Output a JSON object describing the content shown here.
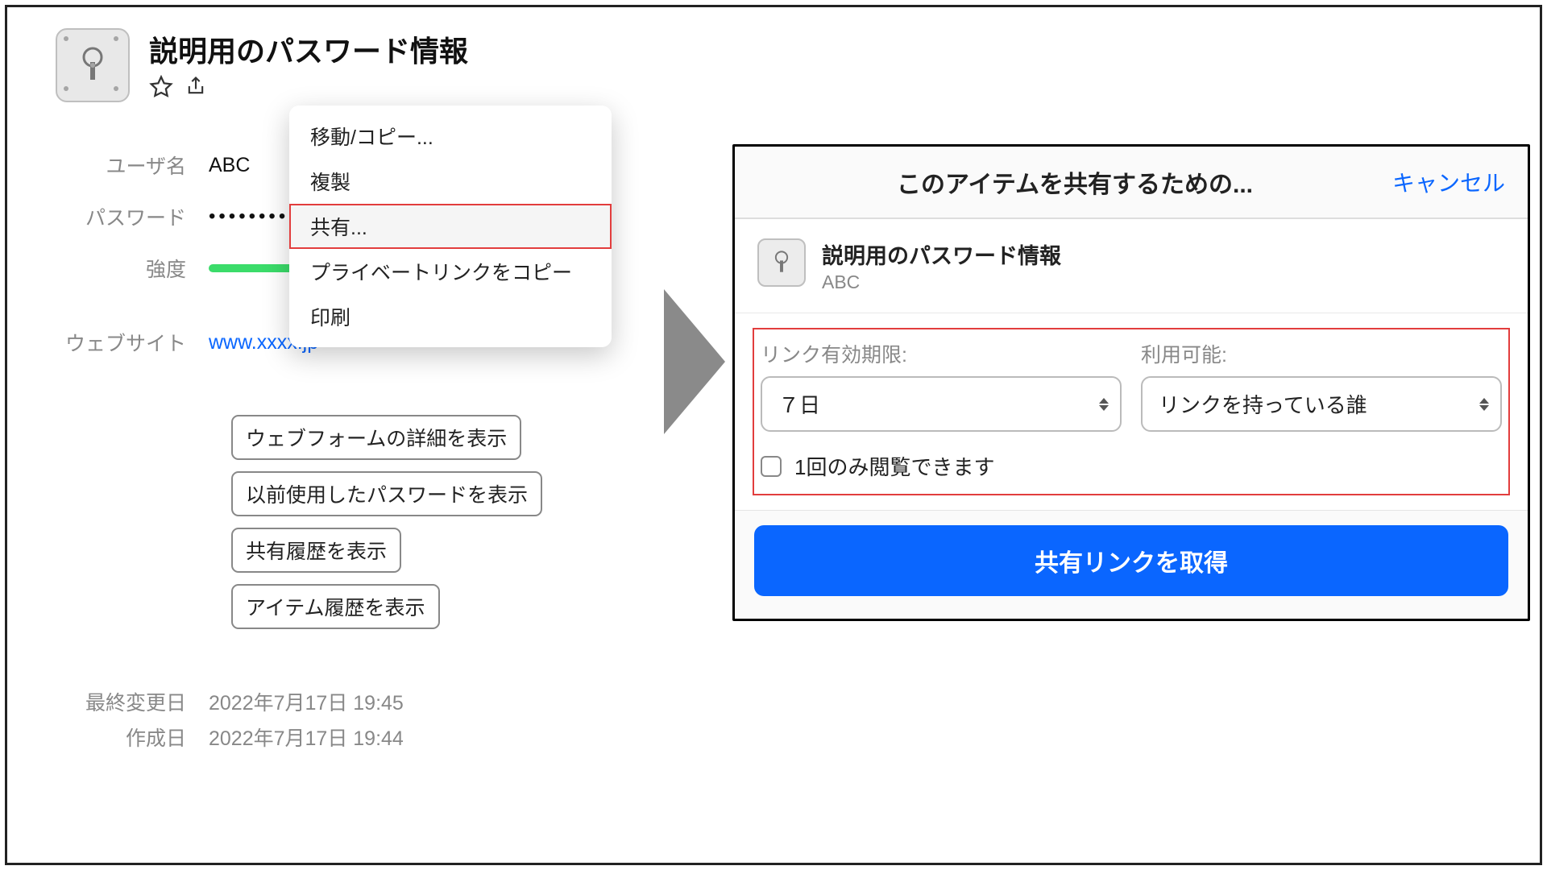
{
  "item": {
    "title": "説明用のパスワード情報",
    "fields": {
      "username_label": "ユーザ名",
      "username_value": "ABC",
      "password_label": "パスワード",
      "password_masked": "••••••••",
      "strength_label": "強度",
      "website_label": "ウェブサイト",
      "website_value": "www.xxxx.jp"
    },
    "actions": {
      "webform_detail": "ウェブフォームの詳細を表示",
      "prev_passwords": "以前使用したパスワードを表示",
      "share_history": "共有履歴を表示",
      "item_history": "アイテム履歴を表示"
    },
    "meta": {
      "modified_label": "最終変更日",
      "modified_value": "2022年7月17日 19:45",
      "created_label": "作成日",
      "created_value": "2022年7月17日 19:44"
    }
  },
  "ctx_menu": {
    "move_copy": "移動/コピー...",
    "duplicate": "複製",
    "share": "共有...",
    "copy_private_link": "プライベートリンクをコピー",
    "print": "印刷"
  },
  "dialog": {
    "title": "このアイテムを共有するための...",
    "cancel": "キャンセル",
    "item_name": "説明用のパスワード情報",
    "item_user": "ABC",
    "expiration_label": "リンク有効期限:",
    "expiration_value": "７日",
    "availability_label": "利用可能:",
    "availability_value": "リンクを持っている誰",
    "view_once_label": "1回のみ閲覧できます",
    "primary_button": "共有リンクを取得"
  }
}
